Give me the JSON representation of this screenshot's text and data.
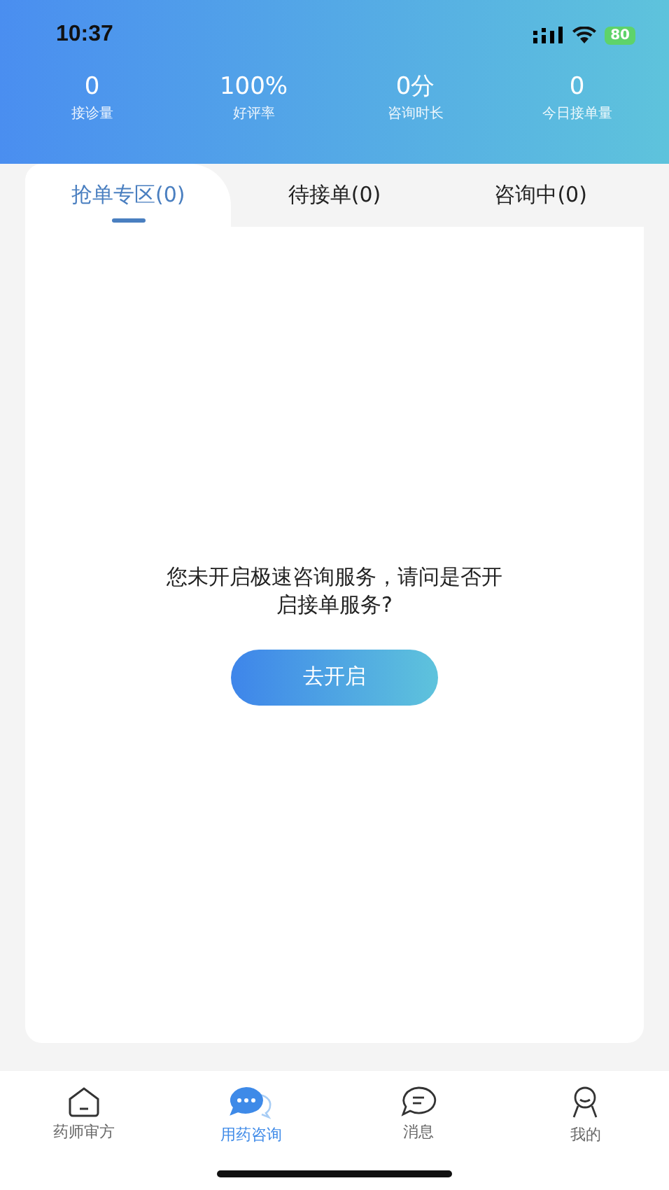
{
  "status_bar": {
    "time": "10:37",
    "battery": "80"
  },
  "stats": [
    {
      "value": "0",
      "label": "接诊量"
    },
    {
      "value": "100%",
      "label": "好评率"
    },
    {
      "value": "0分",
      "label": "咨询时长"
    },
    {
      "value": "0",
      "label": "今日接单量"
    }
  ],
  "tabs": [
    {
      "label": "抢单专区(0)",
      "selected": true
    },
    {
      "label": "待接单(0)",
      "selected": false
    },
    {
      "label": "咨询中(0)",
      "selected": false
    }
  ],
  "empty_state": {
    "message": "您未开启极速咨询服务，请问是否开启接单服务?",
    "button": "去开启"
  },
  "bottom_nav": [
    {
      "kind": "home",
      "label": "药师审方",
      "selected": false
    },
    {
      "kind": "chat",
      "label": "用药咨询",
      "selected": true
    },
    {
      "kind": "message",
      "label": "消息",
      "selected": false
    },
    {
      "kind": "profile",
      "label": "我的",
      "selected": false
    }
  ]
}
